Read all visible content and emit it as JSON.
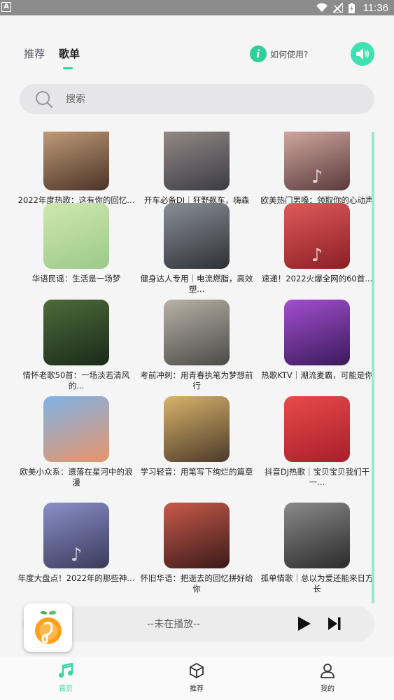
{
  "status_bar": {
    "time": "11:36",
    "left_icon": "A"
  },
  "tabs": [
    {
      "label": "推荐",
      "active": false
    },
    {
      "label": "歌单",
      "active": true
    }
  ],
  "help": {
    "icon": "i",
    "label": "如何使用?"
  },
  "search": {
    "placeholder": "搜索"
  },
  "playlists": [
    {
      "title": "2022年度热歌：这有你的回忆...",
      "colors": [
        "#c8a37e",
        "#4b3327"
      ],
      "icon": ""
    },
    {
      "title": "开车必备DJ｜狂野飙车，嗨森不...",
      "colors": [
        "#9a8f8a",
        "#3b3b46"
      ],
      "icon": ""
    },
    {
      "title": "欧美热门男嗓：领取你的心动声线",
      "colors": [
        "#d8b0a8",
        "#5a3a3a"
      ],
      "icon": "♪"
    },
    {
      "title": "华语民谣：生活是一场梦",
      "colors": [
        "#cfe8b0",
        "#9cc98a"
      ],
      "icon": ""
    },
    {
      "title": "健身达人专用｜电流燃脂，高效塑...",
      "colors": [
        "#8a8f96",
        "#2e3035"
      ],
      "icon": ""
    },
    {
      "title": "速递！2022火爆全网的60首...",
      "colors": [
        "#e05a5a",
        "#8a1f24"
      ],
      "icon": "♪"
    },
    {
      "title": "情怀老歌50首：一场淡若清风的...",
      "colors": [
        "#4e6b3a",
        "#1a2a1a"
      ],
      "icon": ""
    },
    {
      "title": "考前冲刺：用青春执笔为梦想前行",
      "colors": [
        "#b8b2a6",
        "#4a4a48"
      ],
      "icon": ""
    },
    {
      "title": "热歌KTV｜潮流麦霸，可能是你",
      "colors": [
        "#a24fcf",
        "#3a1a5a"
      ],
      "icon": ""
    },
    {
      "title": "欧美小众系：遗落在星河中的浪漫",
      "colors": [
        "#7fb3e6",
        "#e8956b"
      ],
      "icon": ""
    },
    {
      "title": "学习轻音：用笔写下绚烂的篇章",
      "colors": [
        "#d9b36b",
        "#4a3a2a"
      ],
      "icon": ""
    },
    {
      "title": "抖音DJ热歌｜宝贝宝贝我们干一...",
      "colors": [
        "#e84a4a",
        "#a81f2a"
      ],
      "icon": ""
    },
    {
      "title": "年度大盘点！2022年的那些神...",
      "colors": [
        "#8a90c8",
        "#3a3a5a"
      ],
      "icon": "♪"
    },
    {
      "title": "怀旧华语：把逝去的回忆拼好给你",
      "colors": [
        "#c85a4a",
        "#3a1a1a"
      ],
      "icon": ""
    },
    {
      "title": "孤单情歌｜总以为爱还能来日方长",
      "colors": [
        "#8a8a8a",
        "#2a2a2a"
      ],
      "icon": ""
    }
  ],
  "player": {
    "status": "--未在播放--"
  },
  "bottom_nav": [
    {
      "label": "首页",
      "icon": "music-note-icon",
      "active": true
    },
    {
      "label": "推荐",
      "icon": "cube-icon",
      "active": false
    },
    {
      "label": "我的",
      "icon": "user-icon",
      "active": false
    }
  ],
  "colors": {
    "accent": "#35d6a3",
    "accent_light": "#3fe0b1",
    "background": "#f5f5f5"
  }
}
